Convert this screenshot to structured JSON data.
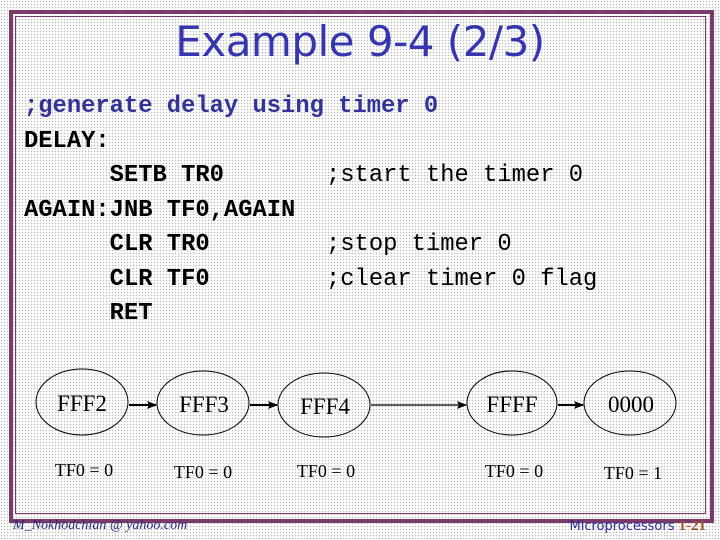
{
  "slide": {
    "title": "Example 9-4 (2/3)",
    "code_lines": [
      {
        "instr": ";generate delay using timer 0",
        "comment": ""
      },
      {
        "instr": "DELAY:",
        "comment": ""
      },
      {
        "instr": "      SETB TR0",
        "comment": ";start the timer 0"
      },
      {
        "instr": "AGAIN:JNB TF0,AGAIN",
        "comment": ""
      },
      {
        "instr": "      CLR TR0",
        "comment": ";stop timer 0"
      },
      {
        "instr": "      CLR TF0",
        "comment": ";clear timer 0 flag"
      },
      {
        "instr": "      RET",
        "comment": ""
      }
    ],
    "diagram": {
      "states": [
        {
          "value": "FFF2",
          "flag": "TF0 = 0"
        },
        {
          "value": "FFF3",
          "flag": "TF0 = 0"
        },
        {
          "value": "FFF4",
          "flag": "TF0 = 0"
        },
        {
          "value": "FFFF",
          "flag": "TF0 = 0"
        },
        {
          "value": "0000",
          "flag": "TF0 = 1"
        }
      ]
    },
    "footer": {
      "email": "M_Nokhodchian @ yahoo.com",
      "course": "Microprocessors",
      "page": "1-21"
    },
    "colors": {
      "title": "#3535b0",
      "border": "#7a3a6a",
      "comment_header": "#333399",
      "page_number": "#a0522d"
    }
  }
}
